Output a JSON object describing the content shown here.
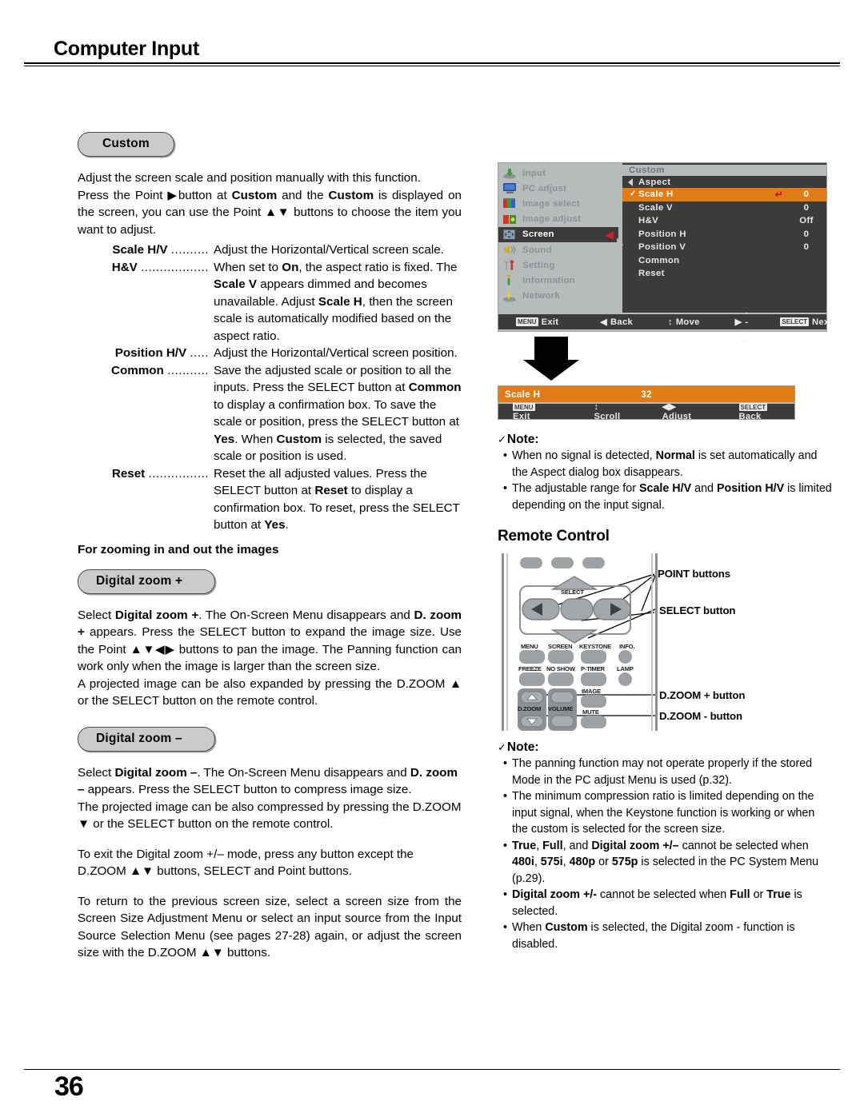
{
  "header": {
    "title": "Computer Input"
  },
  "footer": {
    "page_number": "36"
  },
  "left": {
    "custom_pill": "Custom",
    "intro": [
      "Adjust the screen scale and position manually with this function.",
      "Press the Point ▶button at <b>Custom</b> and the <b>Custom</b> is displayed on the screen, you can use the Point ▲▼ buttons to choose the item you want to adjust."
    ],
    "definitions": [
      {
        "term": "Scale H/V",
        "leader": "..........",
        "desc": "Adjust the Horizontal/Vertical screen scale."
      },
      {
        "term": "H&V",
        "leader": "..................",
        "desc": "When set to <b>On</b>, the aspect ratio is fixed. The <b>Scale V</b> appears dimmed and becomes unavailable. Adjust <b>Scale H</b>, then the screen scale is automatically modified based on the aspect ratio."
      },
      {
        "term": "Position H/V",
        "leader": ".....",
        "desc": "Adjust the Horizontal/Vertical screen position."
      },
      {
        "term": "Common",
        "leader": "...........",
        "desc": "Save the adjusted scale or position to all the inputs. Press the SELECT button at <b>Common</b> to display a confirmation box. To save the scale or position, press the SELECT button at <b>Yes</b>. When <b>Custom</b> is selected, the saved scale or position is used."
      },
      {
        "term": "Reset",
        "leader": "................",
        "desc": "Reset the all adjusted values. Press the SELECT button at <b>Reset</b> to display a confirmation box. To reset, press the SELECT button at <b>Yes</b>."
      }
    ],
    "zoom_subhead": "For zooming in and out the images",
    "dzoom_plus_pill": "Digital zoom +",
    "dzoom_plus_text": [
      "Select <b>Digital zoom +</b>. The On-Screen Menu disappears and <b>D. zoom +</b> appears. Press the SELECT button to expand the image size. Use the Point ▲▼◀▶ buttons to pan the image. The Panning function can work only when the image is larger than the screen size.",
      "A projected image can be also expanded by pressing the D.ZOOM ▲ or the SELECT button on the remote control."
    ],
    "dzoom_minus_pill": "Digital zoom –",
    "dzoom_minus_text": [
      "Select <b>Digital zoom –</b>. The On-Screen Menu disappears and <b>D. zoom –</b> appears. Press the SELECT button to compress image size.",
      "The projected image can be also compressed by pressing the D.ZOOM ▼ or the SELECT button on the remote control.",
      "To exit the Digital zoom +/– mode, press any button except the D.ZOOM ▲▼ buttons, SELECT and Point buttons.",
      "To return to the previous screen size, select a screen size from the Screen Size Adjustment Menu or select an input source from the Input Source Selection Menu (see pages 27-28) again, or adjust the screen size with the D.ZOOM ▲▼ buttons."
    ]
  },
  "osd": {
    "sidebar": [
      {
        "label": "Input",
        "icon": "input-icon",
        "active": false
      },
      {
        "label": "PC adjust",
        "icon": "monitor-icon",
        "active": false
      },
      {
        "label": "Image select",
        "icon": "image-select-icon",
        "active": false
      },
      {
        "label": "Image adjust",
        "icon": "image-adjust-icon",
        "active": false
      },
      {
        "label": "Screen",
        "icon": "screen-icon",
        "active": true
      },
      {
        "label": "Sound",
        "icon": "speaker-icon",
        "active": false
      },
      {
        "label": "Setting",
        "icon": "wrench-icon",
        "active": false
      },
      {
        "label": "Information",
        "icon": "info-icon",
        "active": false
      },
      {
        "label": "Network",
        "icon": "network-icon",
        "active": false
      }
    ],
    "panel_title": "Custom",
    "panel_subtitle": "Aspect",
    "rows": [
      {
        "label": "Scale H",
        "value": "0",
        "selected": true,
        "checked": true,
        "enter": true
      },
      {
        "label": "Scale V",
        "value": "0",
        "selected": false,
        "checked": false,
        "enter": false
      },
      {
        "label": "H&V",
        "value": "Off",
        "selected": false,
        "checked": false,
        "enter": false
      },
      {
        "label": "Position H",
        "value": "0",
        "selected": false,
        "checked": false,
        "enter": false
      },
      {
        "label": "Position V",
        "value": "0",
        "selected": false,
        "checked": false,
        "enter": false
      },
      {
        "label": "Common",
        "value": "",
        "selected": false,
        "checked": false,
        "enter": false
      },
      {
        "label": "Reset",
        "value": "",
        "selected": false,
        "checked": false,
        "enter": false
      }
    ],
    "footer": [
      {
        "key": "MENU",
        "glyph": "",
        "label": "Exit"
      },
      {
        "key": "",
        "glyph": "◀",
        "label": "Back"
      },
      {
        "key": "",
        "glyph": "↕",
        "label": "Move"
      },
      {
        "key": "",
        "glyph": "▶",
        "label": "-----"
      },
      {
        "key": "SELECT",
        "glyph": "",
        "label": "Next"
      }
    ],
    "accent_color": "#e07b16",
    "panel_bg": "#3b3b3b",
    "chrome_bg": "#b7bbbc"
  },
  "scale_dialog": {
    "label": "Scale H",
    "value": "32",
    "footer": [
      {
        "key": "MENU",
        "glyph": "",
        "label": "Exit"
      },
      {
        "key": "",
        "glyph": "↕",
        "label": "Scroll"
      },
      {
        "key": "",
        "glyph": "◀▶",
        "label": "Adjust"
      },
      {
        "key": "SELECT",
        "glyph": "",
        "label": "Back"
      }
    ]
  },
  "note_top": {
    "title": "Note:",
    "items": [
      "When no signal is detected, <b>Normal</b> is set automatically and the Aspect dialog box disappears.",
      "The adjustable range for <b>Scale H/V</b> and <b>Position H/V</b> is limited depending on the input signal."
    ]
  },
  "remote": {
    "section_title": "Remote Control",
    "callouts": [
      {
        "name": "point-buttons-label",
        "text": "POINT buttons"
      },
      {
        "name": "select-button-label",
        "text": "SELECT button"
      },
      {
        "name": "dzoom-plus-label",
        "text": "D.ZOOM + button"
      },
      {
        "name": "dzoom-minus-label",
        "text": "D.ZOOM - button"
      }
    ],
    "button_labels": {
      "select": "SELECT",
      "menu": "MENU",
      "screen": "SCREEN",
      "keystone": "KEYSTONE",
      "info": "INFO.",
      "freeze": "FREEZE",
      "no_show": "NO SHOW",
      "p_timer": "P-TIMER",
      "lamp": "LAMP",
      "image": "IMAGE",
      "dzoom": "D.ZOOM",
      "volume": "VOLUME",
      "mute": "MUTE"
    }
  },
  "note_bottom": {
    "title": "Note:",
    "items": [
      "The panning function may not operate properly if the stored Mode in the PC adjust Menu is used (p.32).",
      "The minimum compression ratio is limited depending on the input signal, when the Keystone function is working or when the custom is selected for the screen size.",
      "<b>True</b>, <b>Full</b>, and <b>Digital zoom +/–</b> cannot be selected when <b>480i</b>, <b>575i</b>, <b>480p</b> or <b>575p</b> is selected in the PC System Menu (p.29).",
      "<b>Digital zoom +/-</b> cannot be selected when <b>Full</b> or <b>True</b> is selected.",
      "When <b>Custom</b> is selected, the Digital zoom - function is disabled."
    ]
  }
}
